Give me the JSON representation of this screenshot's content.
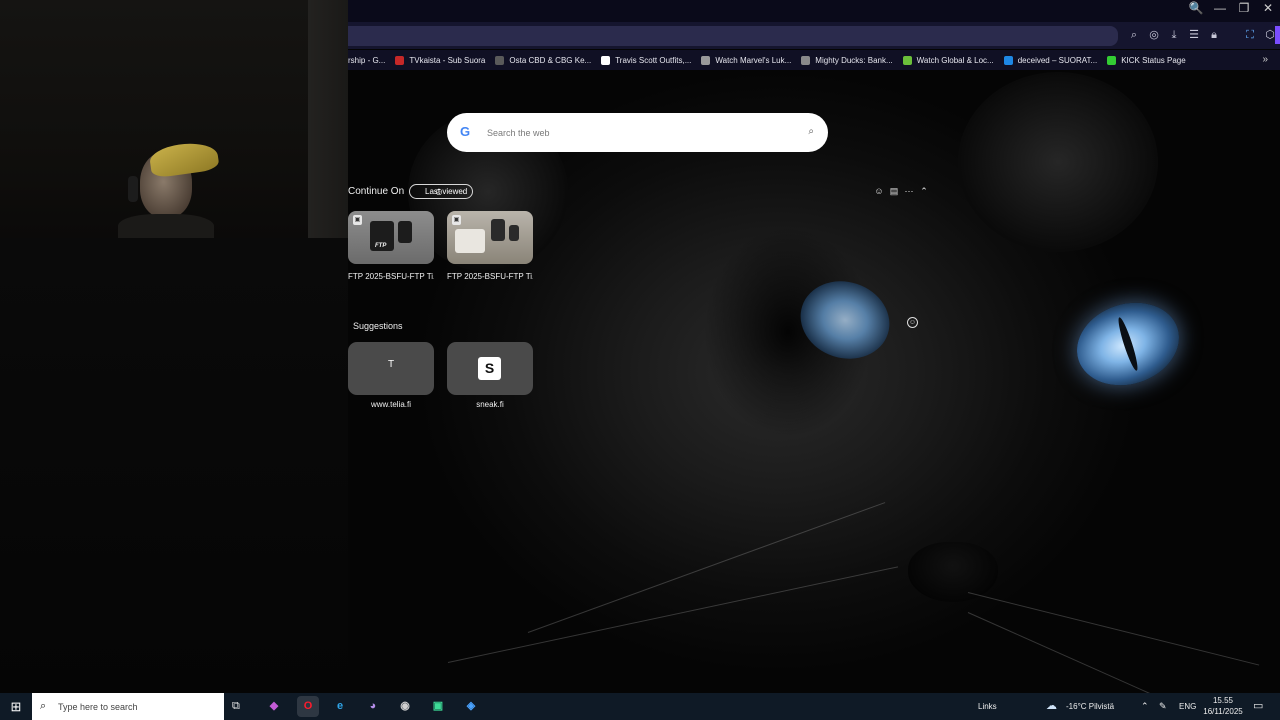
{
  "window": {
    "controls": [
      "🔍",
      "—",
      "❐",
      "✕"
    ]
  },
  "toolbar": {
    "icons": [
      "search-icon",
      "camera-icon",
      "download-icon",
      "menu-icon",
      "lock-icon",
      "translate-icon",
      "extension-icon"
    ]
  },
  "bookmarks": [
    {
      "label": "rship - G...",
      "color": "#6a6a6a"
    },
    {
      "label": "TVkaista - Sub Suora",
      "color": "#c62828"
    },
    {
      "label": "Osta CBD & CBG Ke...",
      "color": "#5a5a5a"
    },
    {
      "label": "Travis Scott Outfits,...",
      "color": "#ffffff"
    },
    {
      "label": "Watch Marvel's Luk...",
      "color": "#9a9a9a"
    },
    {
      "label": "Mighty Ducks: Bank...",
      "color": "#8a8a8a"
    },
    {
      "label": "Watch Global & Loc...",
      "color": "#6bbf3a"
    },
    {
      "label": "deceived – SUORAT...",
      "color": "#1e88e5"
    },
    {
      "label": "KICK Status Page",
      "color": "#33cc33"
    }
  ],
  "search": {
    "placeholder": "Search the web",
    "logo": "G"
  },
  "continue_on": {
    "title": "Continue On",
    "filter_label": "Last viewed",
    "cards": [
      {
        "title": "FTP 2025-BSFU-FTP Ti...",
        "thumb_text": "FTP"
      },
      {
        "title": "FTP 2025-BSFU-FTP Ti...",
        "thumb_text": ""
      }
    ]
  },
  "suggestions": {
    "title": "Suggestions",
    "tiles": [
      {
        "label": "www.telia.fi",
        "glyph": "T"
      },
      {
        "label": "sneak.fi",
        "glyph": "S"
      }
    ]
  },
  "taskbar": {
    "search_placeholder": "Type here to search",
    "links_label": "Links",
    "weather": "-16°C Pilvistä",
    "language": "ENG",
    "time": "15.55",
    "date": "16/11/2025",
    "apps": [
      {
        "name": "copilot",
        "glyph": "◆",
        "color": "#c25bd6"
      },
      {
        "name": "opera",
        "glyph": "O",
        "color": "#ff1b2d"
      },
      {
        "name": "edge",
        "glyph": "e",
        "color": "#2fa4e7"
      },
      {
        "name": "discord",
        "glyph": "◕",
        "color": "#b58ee8"
      },
      {
        "name": "app-grey",
        "glyph": "◉",
        "color": "#d0d0d0"
      },
      {
        "name": "terminal",
        "glyph": "▣",
        "color": "#3ddc97"
      },
      {
        "name": "app-blue",
        "glyph": "◈",
        "color": "#4aa3ff"
      }
    ]
  }
}
